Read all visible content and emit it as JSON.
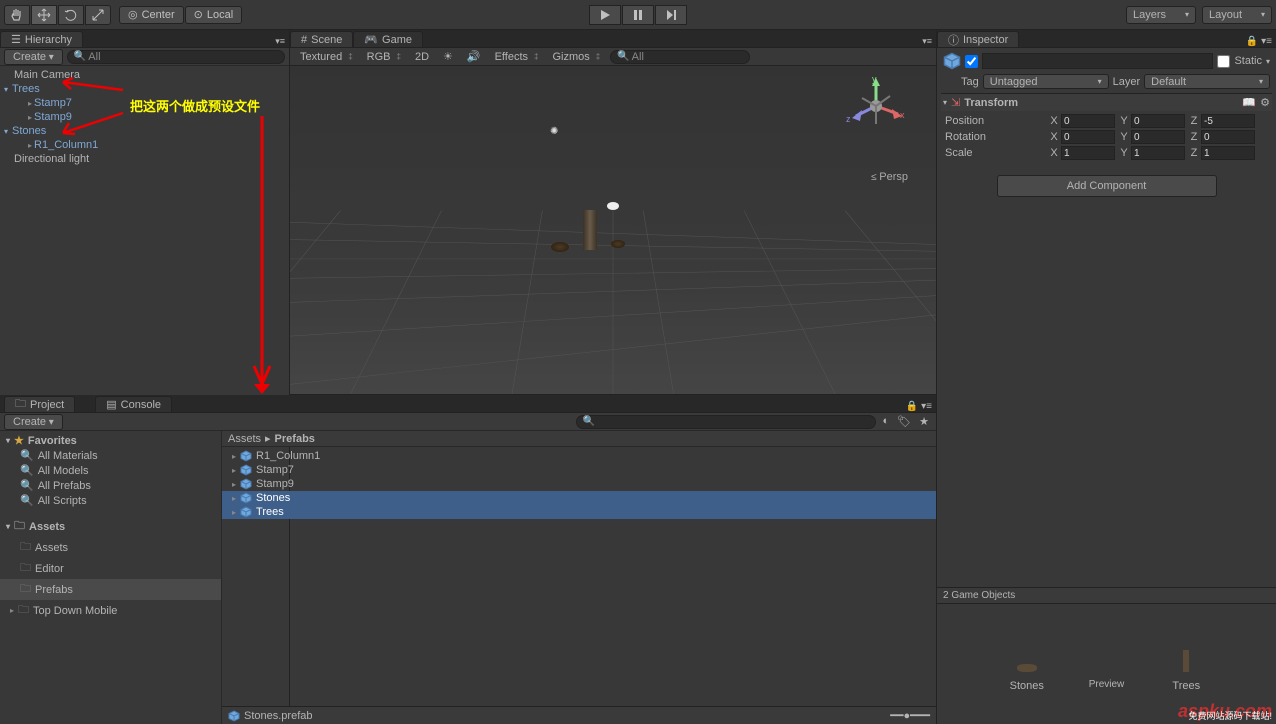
{
  "toolbar": {
    "center_label": "Center",
    "local_label": "Local",
    "layers_label": "Layers",
    "layout_label": "Layout"
  },
  "hierarchy": {
    "tab_label": "Hierarchy",
    "create_label": "Create",
    "search_placeholder": "All",
    "items": [
      {
        "name": "Main Camera",
        "prefab": false,
        "indent": 0
      },
      {
        "name": "Trees",
        "prefab": true,
        "indent": 0,
        "parent": true
      },
      {
        "name": "Stamp7",
        "prefab": true,
        "indent": 1
      },
      {
        "name": "Stamp9",
        "prefab": true,
        "indent": 1
      },
      {
        "name": "Stones",
        "prefab": true,
        "indent": 0,
        "parent": true
      },
      {
        "name": "R1_Column1",
        "prefab": true,
        "indent": 1
      },
      {
        "name": "Directional light",
        "prefab": false,
        "indent": 0
      }
    ],
    "annotation": "把这两个做成预设文件"
  },
  "scene": {
    "tab_scene": "Scene",
    "tab_game": "Game",
    "shading": "Textured",
    "render": "RGB",
    "mode_2d": "2D",
    "effects": "Effects",
    "gizmos": "Gizmos",
    "search_placeholder": "All",
    "persp": "Persp",
    "axes": {
      "x": "x",
      "y": "y",
      "z": "z"
    }
  },
  "project": {
    "tab_project": "Project",
    "tab_console": "Console",
    "create_label": "Create",
    "favorites_label": "Favorites",
    "favorites": [
      "All Materials",
      "All Models",
      "All Prefabs",
      "All Scripts"
    ],
    "assets_label": "Assets",
    "folders": [
      "Assets",
      "Editor",
      "Prefabs",
      "Top Down Mobile"
    ],
    "selected_folder": "Prefabs",
    "breadcrumb": [
      "Assets",
      "Prefabs"
    ],
    "assets": [
      {
        "name": "R1_Column1",
        "selected": false
      },
      {
        "name": "Stamp7",
        "selected": false
      },
      {
        "name": "Stamp9",
        "selected": false
      },
      {
        "name": "Stones",
        "selected": true
      },
      {
        "name": "Trees",
        "selected": true
      }
    ],
    "footer_file": "Stones.prefab"
  },
  "inspector": {
    "tab_label": "Inspector",
    "static_label": "Static",
    "tag_label": "Tag",
    "tag_value": "Untagged",
    "layer_label": "Layer",
    "layer_value": "Default",
    "transform": {
      "label": "Transform",
      "position": {
        "label": "Position",
        "x": "0",
        "y": "0",
        "z": "-5"
      },
      "rotation": {
        "label": "Rotation",
        "x": "0",
        "y": "0",
        "z": "0"
      },
      "scale": {
        "label": "Scale",
        "x": "1",
        "y": "1",
        "z": "1"
      }
    },
    "add_component": "Add Component",
    "preview_header": "2 Game Objects",
    "preview_items": [
      "Stones",
      "Trees"
    ],
    "preview_label": "Preview"
  },
  "watermark": {
    "logo": "aspku.com",
    "sub": "免费网站源码下载站!"
  }
}
